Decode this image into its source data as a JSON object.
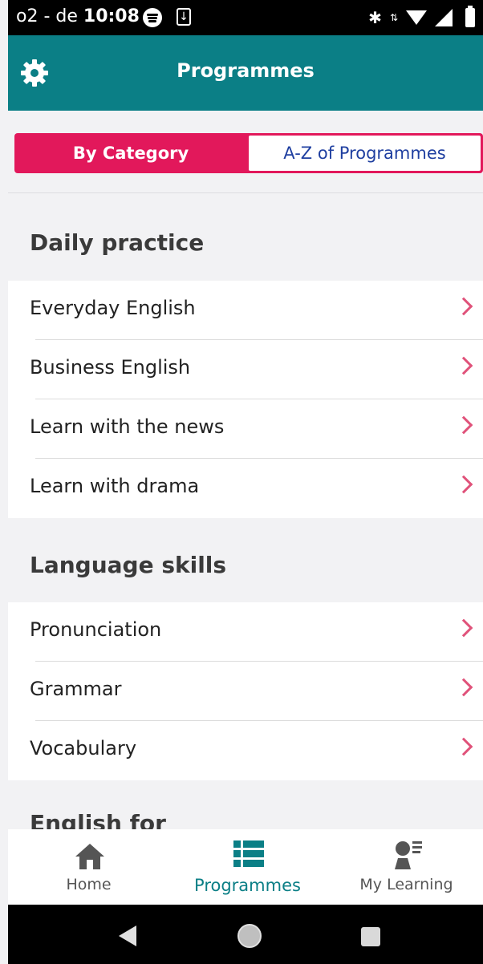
{
  "status_bar": {
    "carrier": "o2 - de",
    "time": "10:08",
    "icons": [
      "spotify-icon",
      "download-icon",
      "bluetooth-icon",
      "data-arrows-icon",
      "wifi-icon",
      "signal-icon",
      "battery-icon"
    ]
  },
  "header": {
    "title": "Programmes",
    "settings_icon": "gear-icon",
    "background": "#0b7f86"
  },
  "segment": {
    "by_category": "By Category",
    "az": "A-Z of Programmes",
    "accent": "#e2185b"
  },
  "sections": [
    {
      "title": "Daily practice",
      "items": [
        "Everyday English",
        "Business English",
        "Learn with the news",
        "Learn with drama"
      ]
    },
    {
      "title": "Language skills",
      "items": [
        "Pronunciation",
        "Grammar",
        "Vocabulary"
      ]
    }
  ],
  "partial_section_title": "English for",
  "bottom_nav": {
    "home": "Home",
    "programmes": "Programmes",
    "my_learning": "My Learning",
    "active": "programmes"
  }
}
